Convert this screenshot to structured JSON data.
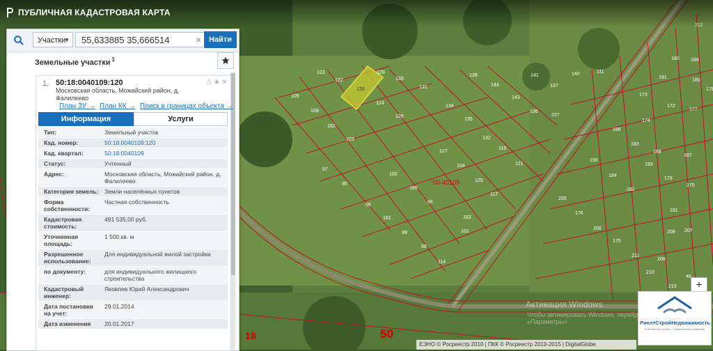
{
  "app": {
    "title": "ПУБЛИЧНАЯ КАДАСТРОВАЯ КАРТА"
  },
  "search": {
    "type_value": "Участки",
    "query": "55,633885 35,666514",
    "find_label": "Найти"
  },
  "results": {
    "title": "Земельные участки",
    "count": "1"
  },
  "card": {
    "number": "1.",
    "cadnum": "50:18:0040109:120",
    "address": "Московская область, Можайский район, д. Фалилеево",
    "links": {
      "plan_zu": "План ЗУ →",
      "plan_kk": "План КК →",
      "search_bounds": "Поиск в границах объекта →"
    },
    "tabs": {
      "info": "Информация",
      "services": "Услуги"
    },
    "rows": [
      {
        "label": "Тип:",
        "value": "Земельный участок"
      },
      {
        "label": "Кад. номер:",
        "value": "50:18:0040109:120"
      },
      {
        "label": "Кад. квартал:",
        "value": "50:18:0040109"
      },
      {
        "label": "Статус:",
        "value": "Учтенный"
      },
      {
        "label": "Адрес:",
        "value": "Московская область, Можайский район, д. Фалилеево"
      },
      {
        "label": "Категория земель:",
        "value": "Земли населённых пунктов"
      },
      {
        "label": "Форма собственности:",
        "value": "Частная собственность"
      },
      {
        "label": "Кадастровая стоимость:",
        "value": "491 535,00 руб."
      },
      {
        "label": "Уточненная площадь:",
        "value": "1 500 кв. м"
      },
      {
        "label": "Разрешенное использование:",
        "value": "Для индивидуальной жилой застройки"
      },
      {
        "label": "по документу:",
        "value": "для индивидуального жилищного строительства"
      },
      {
        "label": "Кадастровый инженер:",
        "value": "Яковлев Юрий Александрович"
      },
      {
        "label": "Дата постановки на учет:",
        "value": "29.01.2014"
      },
      {
        "label": "Дата изменения",
        "value": "20.01.2017"
      }
    ]
  },
  "map": {
    "quarter_label": "00-40109",
    "big_numbers": {
      "left": "18",
      "right": "50"
    },
    "parcels": [
      "123",
      "122",
      "120",
      "128",
      "133",
      "131",
      "139",
      "144",
      "141",
      "137",
      "140",
      "111",
      "105",
      "109",
      "124",
      "126",
      "134",
      "143",
      "136",
      "227",
      "162",
      "103",
      "135",
      "132",
      "127",
      "119",
      "121",
      "97",
      "100",
      "104",
      "125",
      "95",
      "165",
      "117",
      "96",
      "161",
      "94",
      "163",
      "99",
      "101",
      "98",
      "114",
      "212",
      "180",
      "189",
      "185",
      "181",
      "178",
      "173",
      "172",
      "177",
      "174",
      "190",
      "186",
      "183",
      "188",
      "184",
      "182",
      "193",
      "187",
      "179",
      "170",
      "205",
      "176",
      "191",
      "206",
      "209",
      "207",
      "175",
      "208",
      "211",
      "210",
      "213",
      "46"
    ]
  },
  "zoom_plus": "+",
  "watermark": {
    "line1": "Активация Windows",
    "line2": "Чтобы активировать Windows, перейдите в раздел «Параметры»"
  },
  "brand": {
    "name": "РиелтСтройНедвижимость",
    "sub": "Риелторские услуги · Строительные компании"
  },
  "copyright": "ЕЭНО © Росреестр 2010 | ПКК © Росреестр 2010-2015 | DigitalGlobe",
  "colors": {
    "accent": "#1a6fbd",
    "parcel_border": "#c0102a",
    "selected_parcel": "#c8c832"
  }
}
